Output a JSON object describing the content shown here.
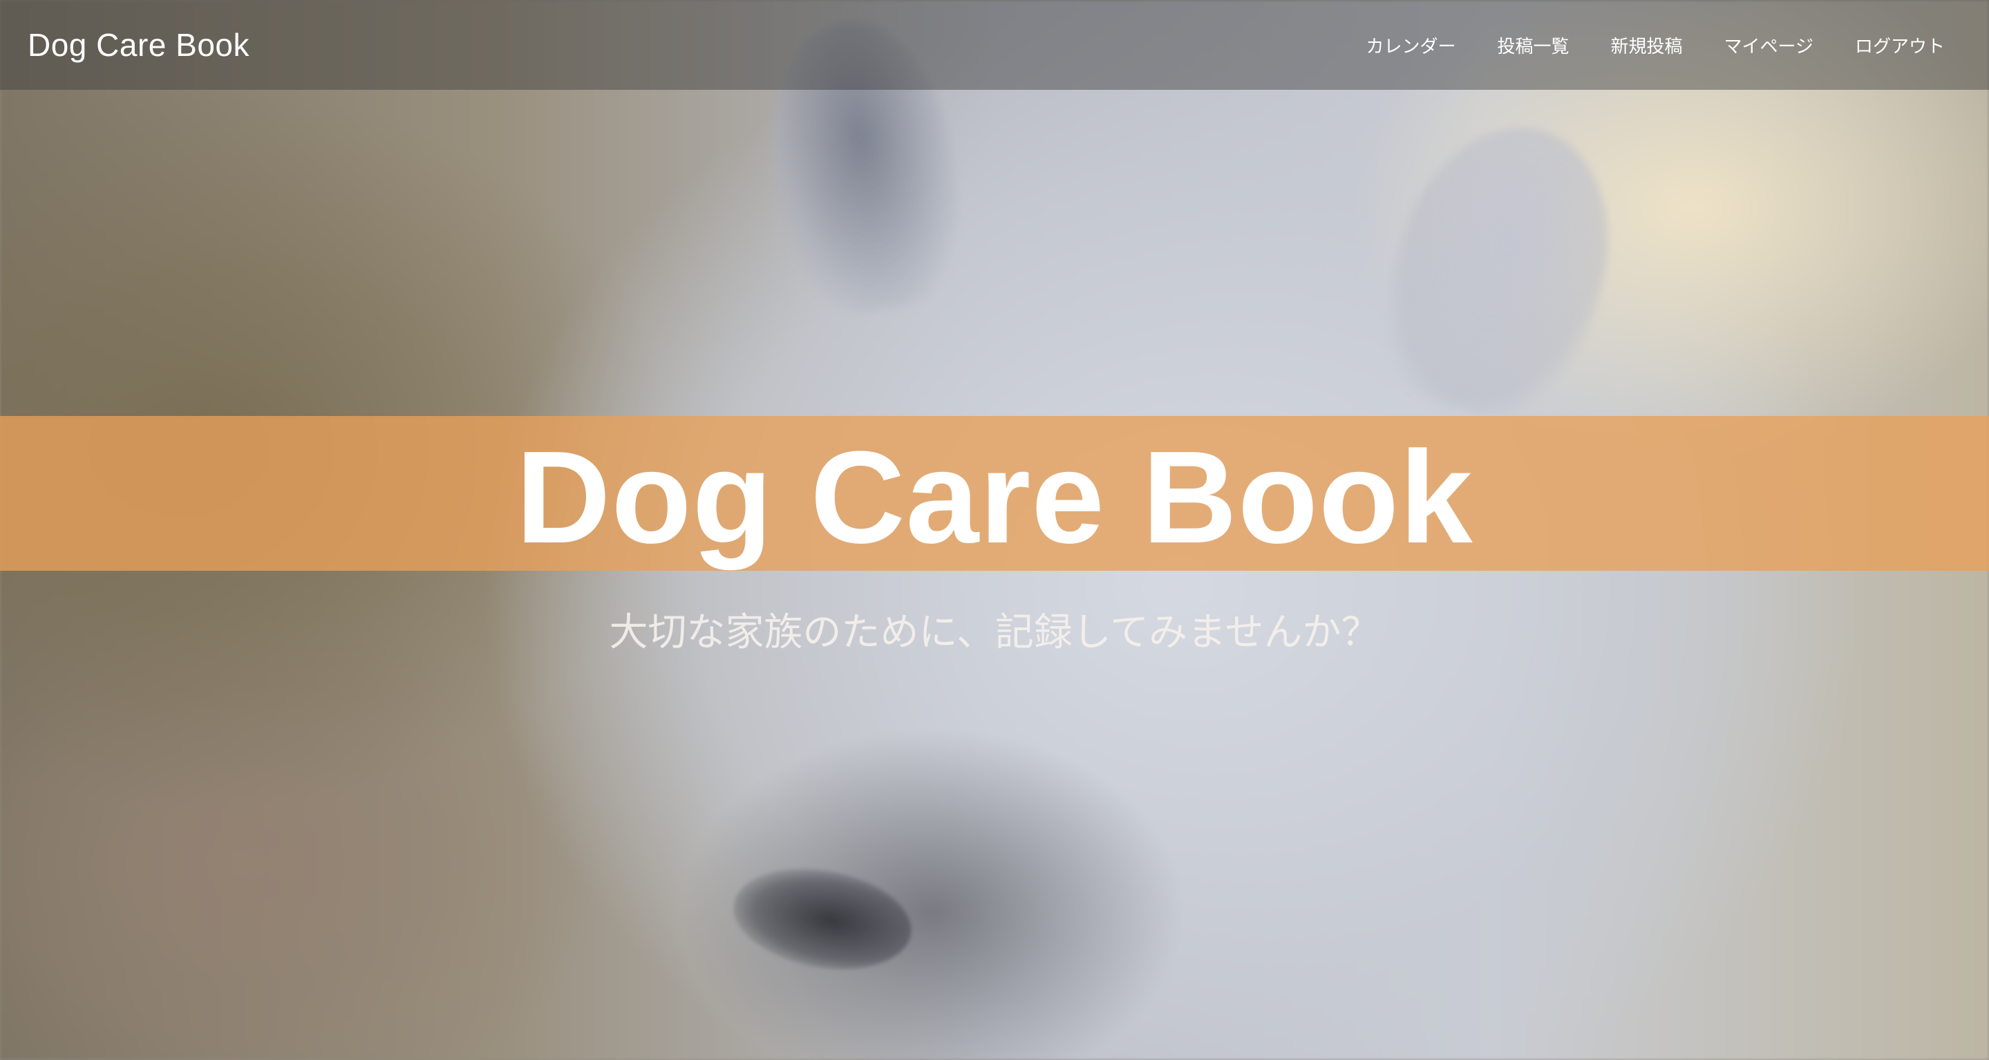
{
  "navbar": {
    "brand": "Dog Care Book",
    "links": [
      {
        "label": "カレンダー"
      },
      {
        "label": "投稿一覧"
      },
      {
        "label": "新規投稿"
      },
      {
        "label": "マイページ"
      },
      {
        "label": "ログアウト"
      }
    ]
  },
  "hero": {
    "title": "Dog Care Book",
    "subtitle": "大切な家族のために、記録してみませんか？",
    "band_color": "#e8a05a",
    "background_image": "white-spitz-dog-photo"
  }
}
